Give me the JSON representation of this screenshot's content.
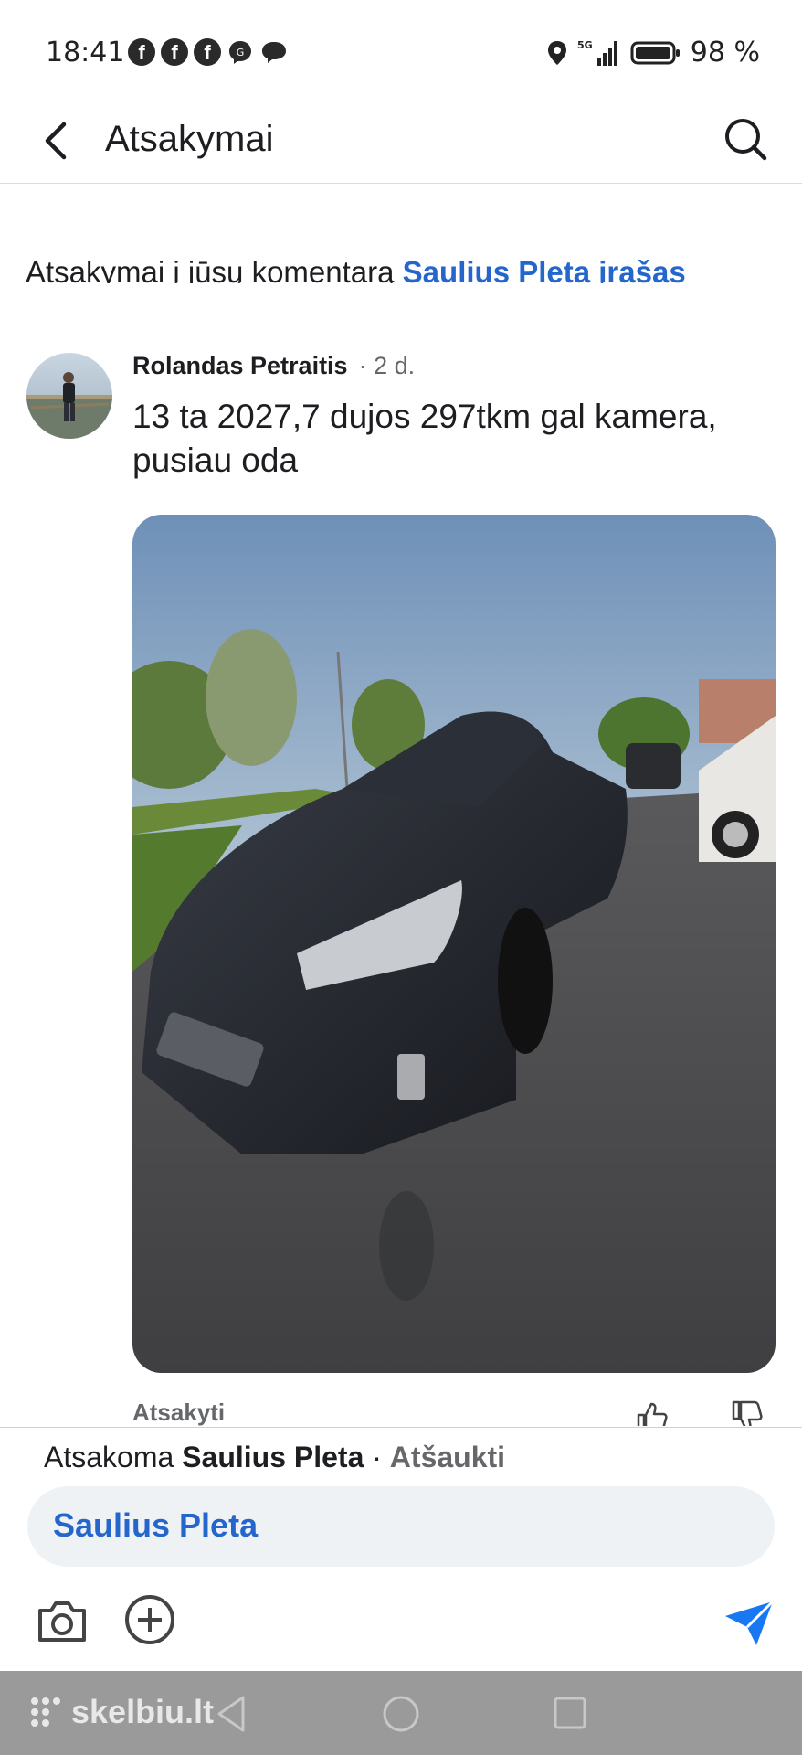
{
  "status": {
    "time": "18:41",
    "network": "5G",
    "battery": "98 %",
    "icons_left": [
      "facebook-icon",
      "facebook-icon",
      "facebook-icon",
      "messenger-icon",
      "chat-icon"
    ]
  },
  "header": {
    "title": "Atsakymai",
    "back_icon": "back-arrow-icon",
    "search_icon": "search-icon"
  },
  "context": {
    "prefix": "Atsakymai į jūsų komentarą ",
    "link": "Saulius Pleta įrašas"
  },
  "comment": {
    "author": "Rolandas Petraitis",
    "time": "· 2 d.",
    "text": "13 ta 2027,7 dujos 297tkm gal kamera, pusiau oda",
    "photo_description_icon": "car-photo"
  },
  "actions": {
    "reply": "Atsakyti",
    "like_icon": "thumbs-up-icon",
    "dislike_icon": "thumbs-down-icon"
  },
  "composer": {
    "replying_prefix": "Atsakoma ",
    "replying_name": "Saulius Pleta",
    "separator": " · ",
    "cancel": "Atšaukti",
    "input_value": "Saulius Pleta"
  },
  "watermark": "skelbiu.lt",
  "colors": {
    "link": "#2466cc",
    "muted": "#65676b",
    "input_bg": "#eff2f5",
    "send": "#1877f2",
    "navbar": "#9a9a9a"
  }
}
